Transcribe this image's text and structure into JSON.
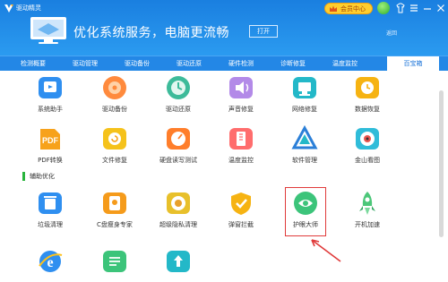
{
  "app": {
    "name": "驱动精灵",
    "member_label": "会员中心",
    "slogan": "优化系统服务，电脑更流畅",
    "open_label": "打开",
    "back_label": "返回"
  },
  "tabs": [
    {
      "label": "检测概要"
    },
    {
      "label": "驱动管理"
    },
    {
      "label": "驱动备份"
    },
    {
      "label": "驱动还原"
    },
    {
      "label": "硬件检测"
    },
    {
      "label": "诊断修复"
    },
    {
      "label": "温度监控"
    },
    {
      "label": "百宝箱"
    }
  ],
  "active_tab": "百宝箱",
  "tools_row1": [
    {
      "label": "系统助手",
      "icon": "system-helper-icon"
    },
    {
      "label": "驱动备份",
      "icon": "driver-backup-icon"
    },
    {
      "label": "驱动还原",
      "icon": "driver-restore-icon"
    },
    {
      "label": "声音修复",
      "icon": "sound-repair-icon"
    },
    {
      "label": "网络修复",
      "icon": "network-repair-icon"
    },
    {
      "label": "数据恢复",
      "icon": "data-recovery-icon"
    }
  ],
  "tools_row2": [
    {
      "label": "PDF转换",
      "icon": "pdf-convert-icon"
    },
    {
      "label": "文件修复",
      "icon": "file-repair-icon"
    },
    {
      "label": "硬盘读写测试",
      "icon": "disk-test-icon"
    },
    {
      "label": "温度监控",
      "icon": "temperature-icon"
    },
    {
      "label": "软件管理",
      "icon": "software-manager-icon"
    },
    {
      "label": "金山看图",
      "icon": "image-viewer-icon"
    }
  ],
  "section": {
    "title": "辅助优化"
  },
  "tools_row3": [
    {
      "label": "垃圾清理",
      "icon": "trash-clean-icon"
    },
    {
      "label": "C盘瘦身专家",
      "icon": "c-drive-slim-icon"
    },
    {
      "label": "超级隐私清理",
      "icon": "privacy-clean-icon"
    },
    {
      "label": "弹窗拦截",
      "icon": "popup-block-icon"
    },
    {
      "label": "护眼大师",
      "icon": "eye-care-icon"
    },
    {
      "label": "开机加速",
      "icon": "boot-speed-icon"
    }
  ],
  "colors": {
    "brand_blue": "#2387e6",
    "highlight_red": "#e03a3a",
    "section_green": "#28b43c",
    "member_gold": "#ffce2e"
  }
}
